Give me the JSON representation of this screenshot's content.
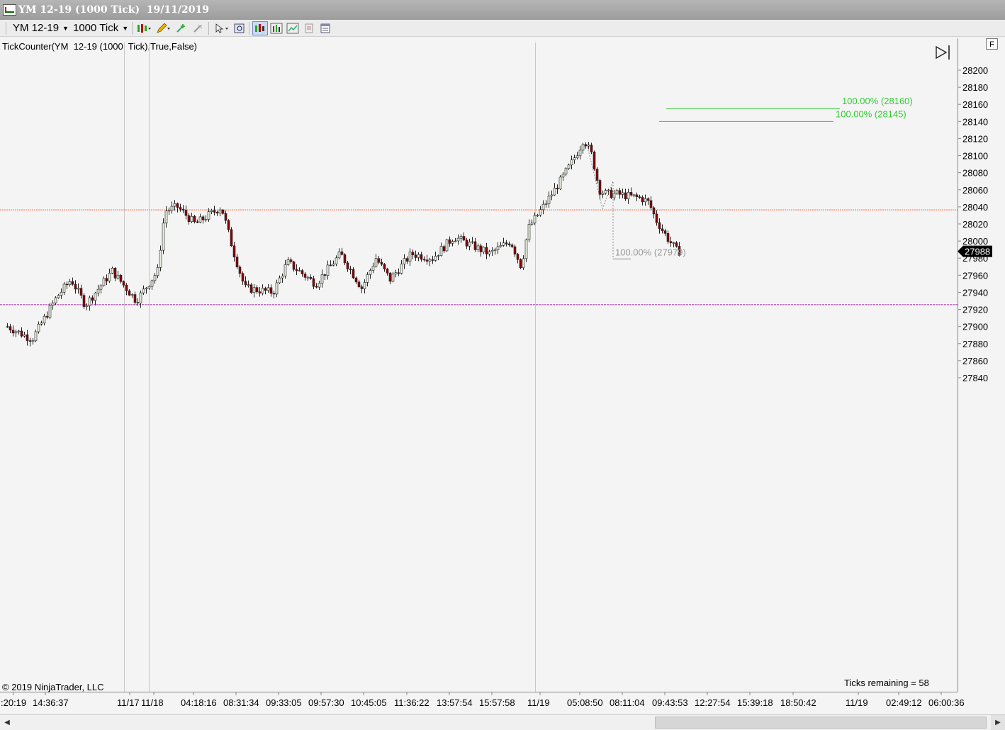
{
  "window": {
    "title": "YM 12-19 (1000 Tick)  19/11/2019"
  },
  "toolbar": {
    "instrument": "YM 12-19",
    "interval": "1000 Tick",
    "tools": [
      "bar-type-icon",
      "pencil-draw-icon",
      "add-crosshair-icon",
      "remove-drawing-icon",
      "pointer-icon",
      "zoom-icon",
      "chart-style-icon",
      "bar-chart-icon",
      "line-chart-icon",
      "properties-icon",
      "data-box-icon"
    ]
  },
  "chart": {
    "indicator_label": "TickCounter(YM  12-19 (1000  Tick),True,False)",
    "copyright": "© 2019 NinjaTrader, LLC",
    "ticks_remaining": "Ticks remaining = 58",
    "f_button": "F",
    "current_price": "27988",
    "y_axis_ticks": [
      28200,
      28180,
      28160,
      28140,
      28120,
      28100,
      28080,
      28060,
      28040,
      28020,
      28000,
      27980,
      27960,
      27940,
      27920,
      27900,
      27880,
      27860,
      27840
    ],
    "x_axis_labels": [
      ":20:19",
      "14:36:37",
      "11/17",
      "11/18",
      "04:18:16",
      "08:31:34",
      "09:33:05",
      "09:57:30",
      "10:45:05",
      "11:36:22",
      "13:57:54",
      "15:57:58",
      "11/19",
      "05:08:50",
      "08:11:04",
      "09:43:53",
      "12:27:54",
      "15:39:18",
      "18:50:42",
      "11/19",
      "02:49:12",
      "06:00:36"
    ],
    "target_labels": [
      "100.00% (28160)",
      "100.00% (28145)"
    ],
    "low_label": "100.00% (27979)",
    "horizontal_lines": [
      28036.5,
      27925.5
    ],
    "colors": {
      "background": "#f4f4f4",
      "up_candle": "#e8f0e0",
      "down_candle": "#8b0000",
      "target": "#33cc33",
      "orange_line": "#ff6633",
      "purple_line": "#a020a0",
      "price_badge": "#000000"
    }
  }
}
